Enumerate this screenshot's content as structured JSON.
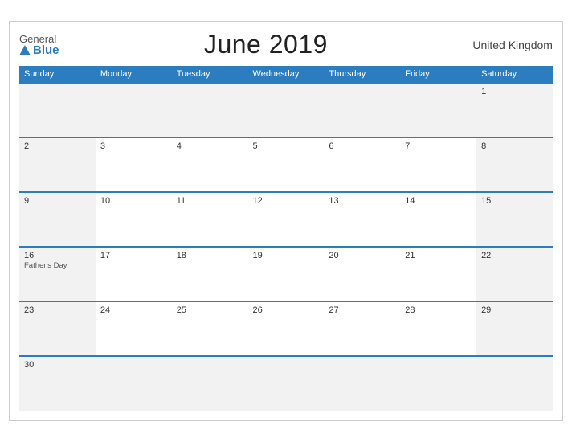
{
  "header": {
    "logo_general": "General",
    "logo_blue": "Blue",
    "title": "June 2019",
    "region": "United Kingdom"
  },
  "days_of_week": [
    "Sunday",
    "Monday",
    "Tuesday",
    "Wednesday",
    "Thursday",
    "Friday",
    "Saturday"
  ],
  "weeks": [
    [
      {
        "date": "",
        "event": "",
        "empty": true
      },
      {
        "date": "",
        "event": "",
        "empty": true
      },
      {
        "date": "",
        "event": "",
        "empty": true
      },
      {
        "date": "",
        "event": "",
        "empty": true
      },
      {
        "date": "",
        "event": "",
        "empty": true
      },
      {
        "date": "",
        "event": "",
        "empty": true
      },
      {
        "date": "1",
        "event": ""
      }
    ],
    [
      {
        "date": "2",
        "event": ""
      },
      {
        "date": "3",
        "event": ""
      },
      {
        "date": "4",
        "event": ""
      },
      {
        "date": "5",
        "event": ""
      },
      {
        "date": "6",
        "event": ""
      },
      {
        "date": "7",
        "event": ""
      },
      {
        "date": "8",
        "event": ""
      }
    ],
    [
      {
        "date": "9",
        "event": ""
      },
      {
        "date": "10",
        "event": ""
      },
      {
        "date": "11",
        "event": ""
      },
      {
        "date": "12",
        "event": ""
      },
      {
        "date": "13",
        "event": ""
      },
      {
        "date": "14",
        "event": ""
      },
      {
        "date": "15",
        "event": ""
      }
    ],
    [
      {
        "date": "16",
        "event": "Father's Day"
      },
      {
        "date": "17",
        "event": ""
      },
      {
        "date": "18",
        "event": ""
      },
      {
        "date": "19",
        "event": ""
      },
      {
        "date": "20",
        "event": ""
      },
      {
        "date": "21",
        "event": ""
      },
      {
        "date": "22",
        "event": ""
      }
    ],
    [
      {
        "date": "23",
        "event": ""
      },
      {
        "date": "24",
        "event": ""
      },
      {
        "date": "25",
        "event": ""
      },
      {
        "date": "26",
        "event": ""
      },
      {
        "date": "27",
        "event": ""
      },
      {
        "date": "28",
        "event": ""
      },
      {
        "date": "29",
        "event": ""
      }
    ],
    [
      {
        "date": "30",
        "event": ""
      },
      {
        "date": "",
        "event": "",
        "empty": true
      },
      {
        "date": "",
        "event": "",
        "empty": true
      },
      {
        "date": "",
        "event": "",
        "empty": true
      },
      {
        "date": "",
        "event": "",
        "empty": true
      },
      {
        "date": "",
        "event": "",
        "empty": true
      },
      {
        "date": "",
        "event": "",
        "empty": true
      }
    ]
  ]
}
